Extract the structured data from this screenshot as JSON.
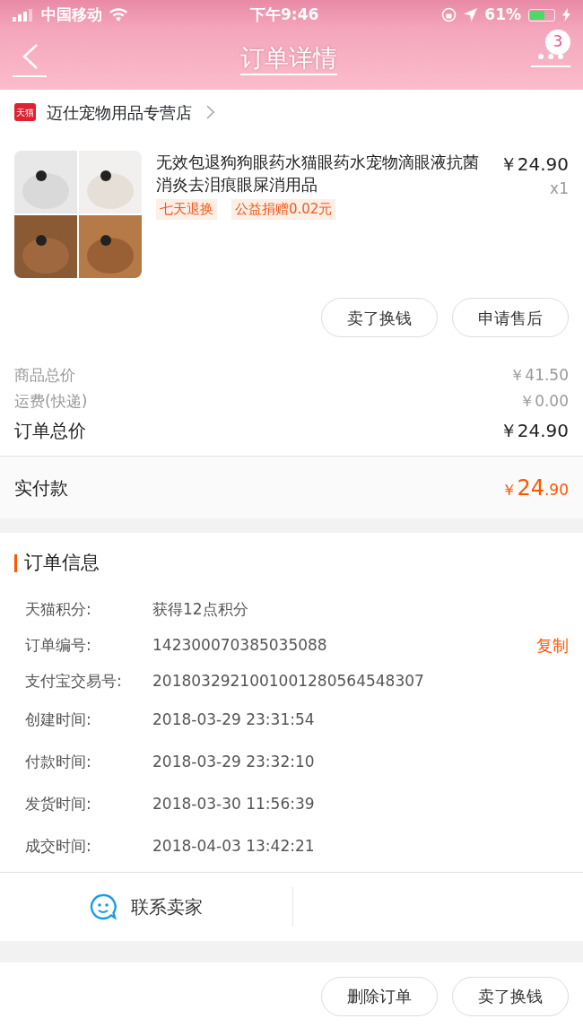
{
  "status_bar": {
    "carrier": "中国移动",
    "time": "下午9:46",
    "battery": "61%"
  },
  "nav": {
    "title": "订单详情",
    "badge": "3"
  },
  "store": {
    "logo": "天猫",
    "name": "迈仕宠物用品专营店"
  },
  "product": {
    "title": "无效包退狗狗眼药水猫眼药水宠物滴眼液抗菌消炎去泪痕眼屎消用品",
    "price": "￥24.90",
    "quantity": "x1",
    "tags": [
      "七天退换",
      "公益捐赠0.02元"
    ],
    "actions": [
      "卖了换钱",
      "申请售后"
    ]
  },
  "summary": [
    {
      "label": "商品总价",
      "value": "￥41.50",
      "kind": "minor"
    },
    {
      "label": "运费(快递)",
      "value": "￥0.00",
      "kind": "minor"
    },
    {
      "label": "订单总价",
      "value": "￥24.90",
      "kind": "major"
    }
  ],
  "paid": {
    "label": "实付款",
    "currency": "￥",
    "amount": "24",
    "decimals": ".90"
  },
  "info": {
    "title": "订单信息",
    "rows": [
      {
        "label": "天猫积分:",
        "value": "获得12点积分"
      },
      {
        "label": "订单编号:",
        "value": "142300070385035088",
        "action": "复制"
      },
      {
        "label": "支付宝交易号:",
        "value": "2018032921001001280564548307"
      },
      {
        "label": "创建时间:",
        "value": "2018-03-29 23:31:54"
      },
      {
        "label": "付款时间:",
        "value": "2018-03-29 23:32:10"
      },
      {
        "label": "发货时间:",
        "value": "2018-03-30 11:56:39"
      },
      {
        "label": "成交时间:",
        "value": "2018-04-03 13:42:21"
      }
    ]
  },
  "contact": {
    "label": "联系卖家"
  },
  "bottom_buttons": [
    "删除订单",
    "卖了换钱"
  ]
}
